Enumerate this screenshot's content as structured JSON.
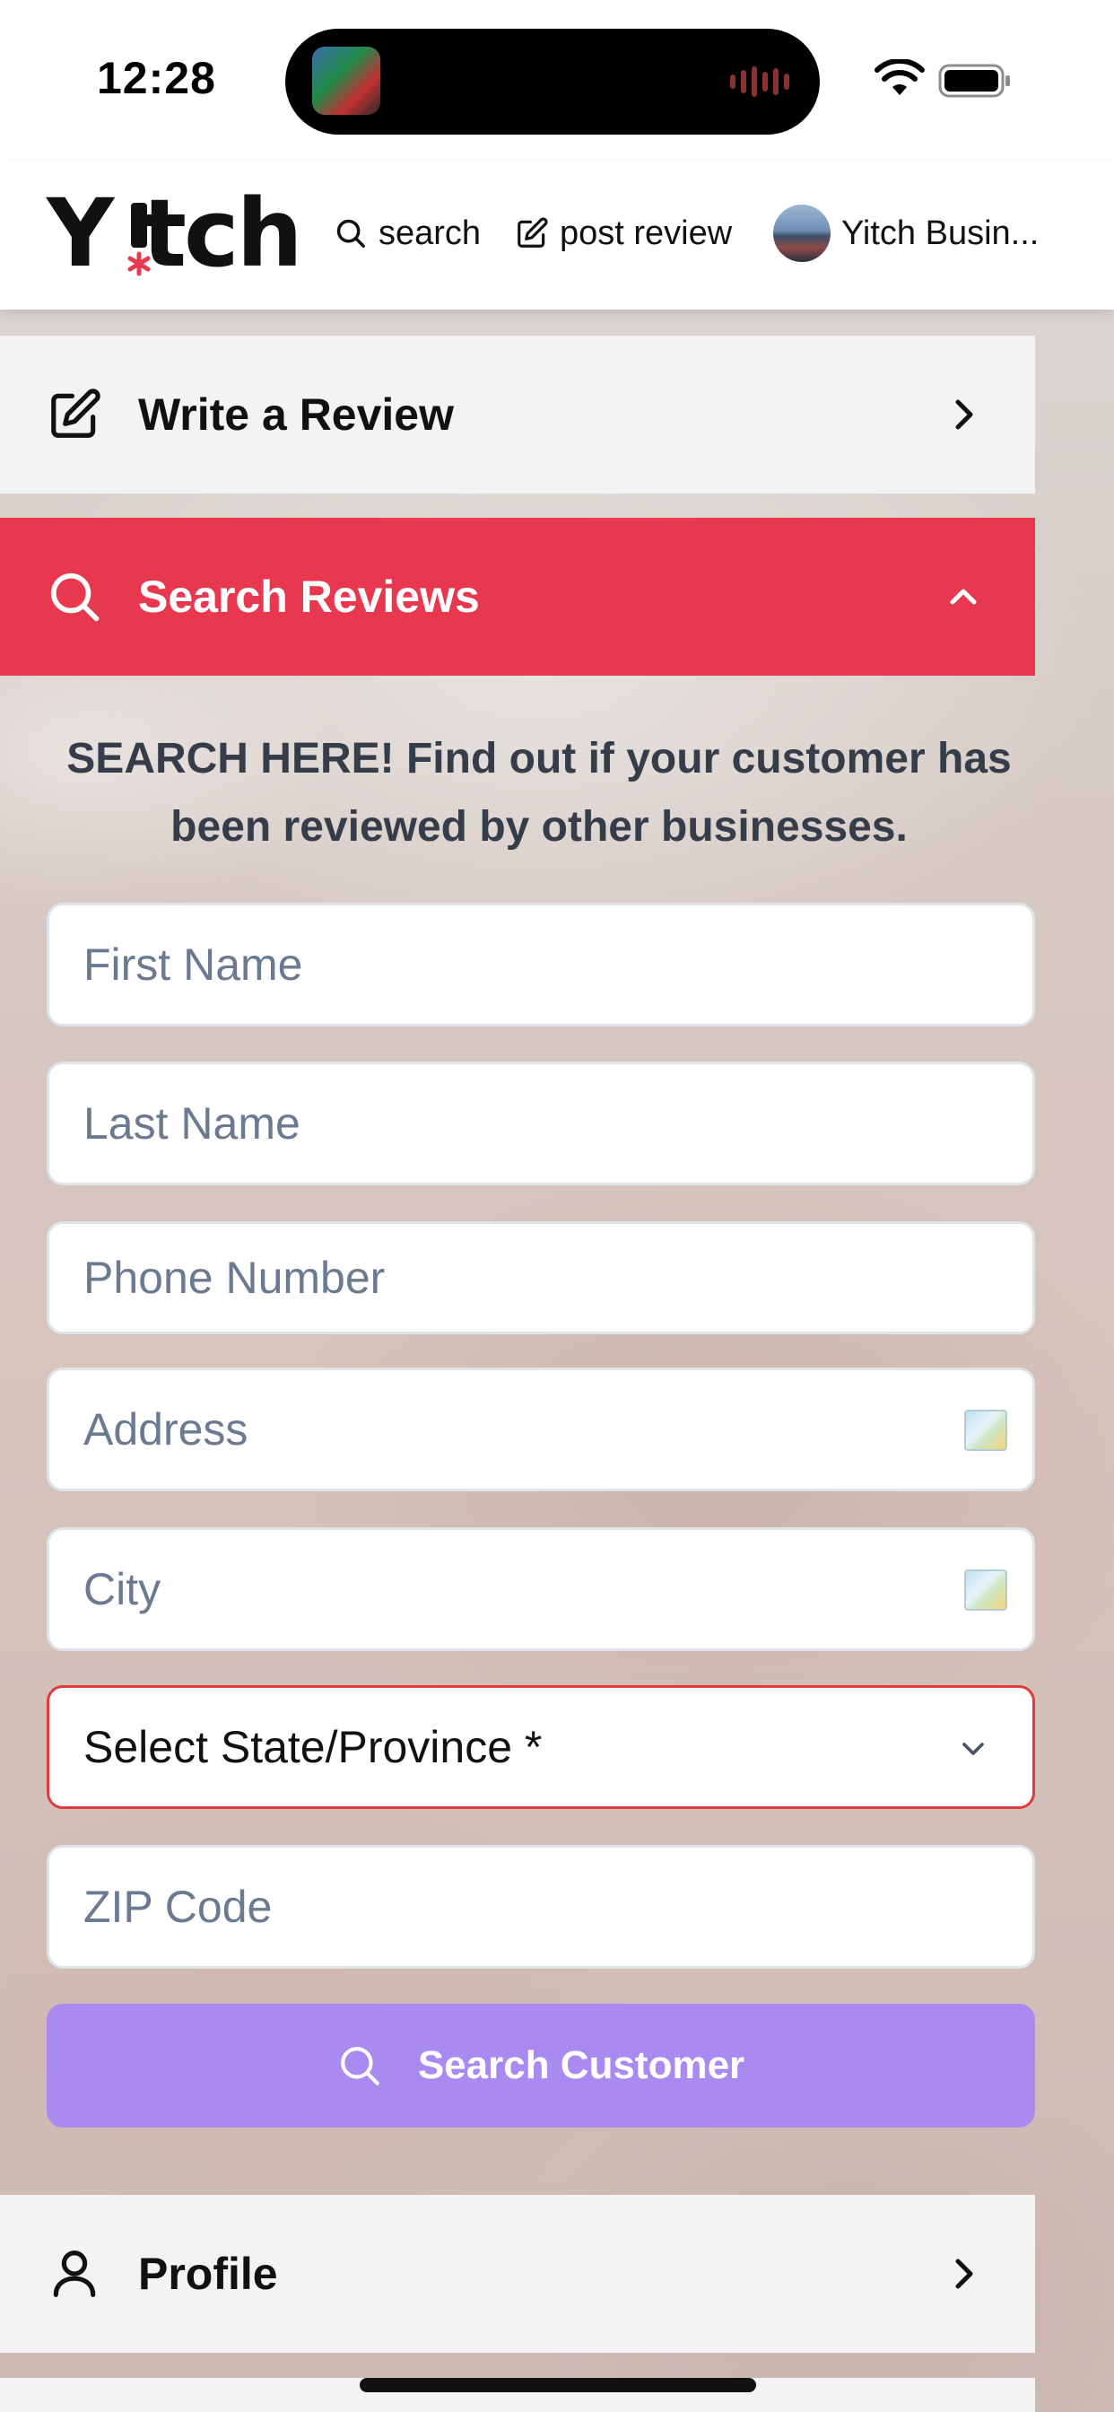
{
  "status_bar": {
    "time": "12:28",
    "icons": [
      "now-playing-artwork",
      "audio-waveform-icon",
      "wifi-icon",
      "battery-icon"
    ]
  },
  "header": {
    "logo": "Yitch",
    "nav": {
      "search_label": "search",
      "post_review_label": "post review",
      "account_label": "Yitch Busin..."
    }
  },
  "panels": {
    "write_review": {
      "label": "Write a Review",
      "icon": "edit-icon",
      "state": "collapsed"
    },
    "search_reviews": {
      "label": "Search Reviews",
      "icon": "search-icon",
      "state": "expanded"
    },
    "profile": {
      "label": "Profile",
      "icon": "user-icon",
      "state": "collapsed"
    }
  },
  "search_form": {
    "intro": "SEARCH HERE! Find out if your customer has been reviewed by other businesses.",
    "first_name_placeholder": "First Name",
    "last_name_placeholder": "Last Name",
    "phone_placeholder": "Phone Number",
    "address_placeholder": "Address",
    "city_placeholder": "City",
    "state_selected": "Select State/Province *",
    "zip_placeholder": "ZIP Code",
    "submit_label": "Search Customer"
  },
  "colors": {
    "accent_red": "#e8384f",
    "button_purple": "#a98af0",
    "panel_gray": "#f2f3f5",
    "error_border": "#e03a3a"
  }
}
